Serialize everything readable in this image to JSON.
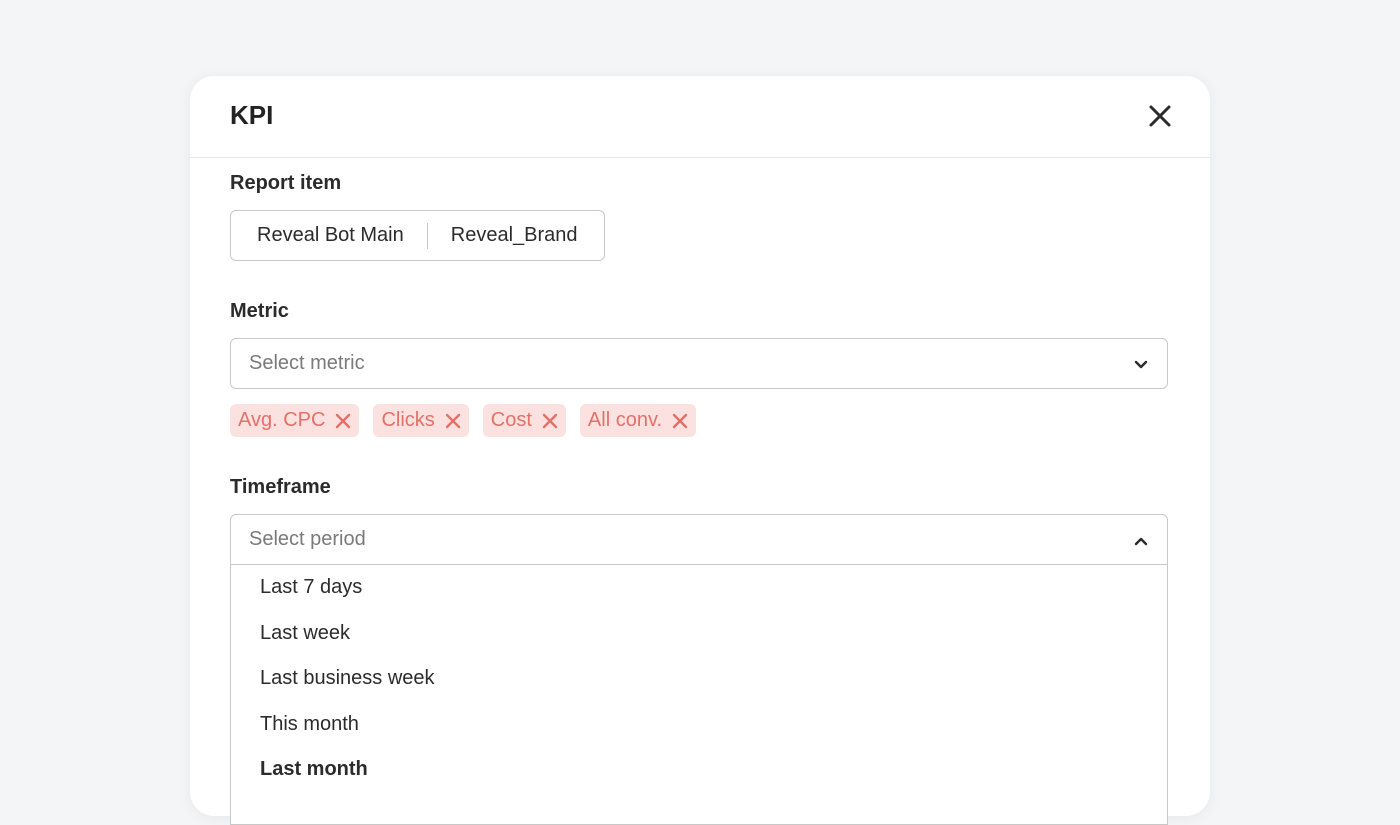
{
  "modal": {
    "title": "KPI"
  },
  "report_item": {
    "label": "Report item",
    "segments": [
      "Reveal Bot Main",
      "Reveal_Brand"
    ]
  },
  "metric": {
    "label": "Metric",
    "placeholder": "Select metric",
    "tags": [
      "Avg. CPC",
      "Clicks",
      "Cost",
      "All conv."
    ]
  },
  "timeframe": {
    "label": "Timeframe",
    "placeholder": "Select period",
    "options": [
      "Last 7 days",
      "Last week",
      "Last business week",
      "This month",
      "Last month"
    ],
    "highlighted_option": "Last month"
  },
  "icons": {
    "close": "close-icon",
    "metric_chevron": "chevron-down-icon",
    "timeframe_chevron": "chevron-up-icon",
    "tag_remove": "remove-tag-icon"
  },
  "colors": {
    "tag_bg": "#fbe2e0",
    "tag_text": "#e4706a",
    "border": "#c8c8c8",
    "background": "#f4f5f7"
  }
}
